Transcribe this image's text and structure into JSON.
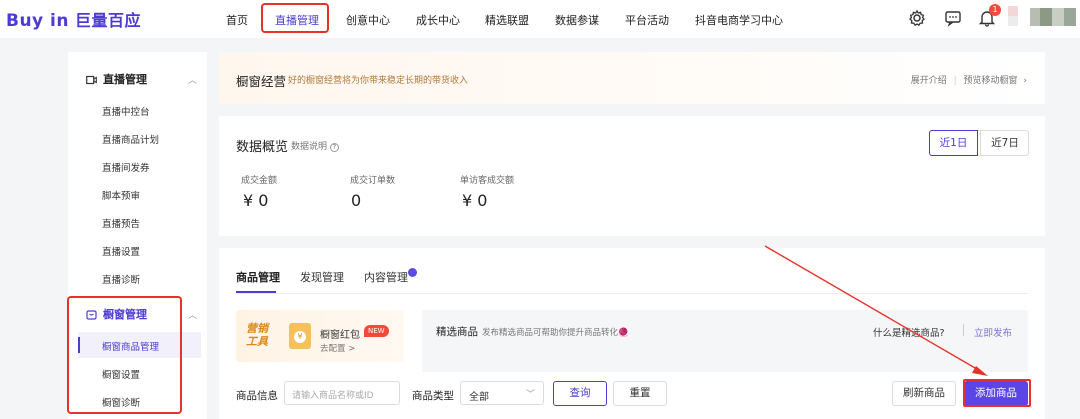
{
  "app": {
    "logo_text": "Buy in",
    "logo_cn": "巨量百应"
  },
  "nav": {
    "items": [
      "首页",
      "直播管理",
      "创意中心",
      "成长中心",
      "精选联盟",
      "数据参谋",
      "平台活动",
      "抖音电商学习中心"
    ],
    "notification_count": "1"
  },
  "sidebar": {
    "live_section": {
      "title": "直播管理",
      "items": [
        "直播中控台",
        "直播商品计划",
        "直播间发券",
        "脚本预审",
        "直播预告",
        "直播设置",
        "直播诊断"
      ]
    },
    "window_section": {
      "title": "橱窗管理",
      "items": [
        "橱窗商品管理",
        "橱窗设置",
        "橱窗诊断"
      ],
      "active_index": 0
    }
  },
  "banner": {
    "title": "橱窗经营",
    "subtitle": "好的橱窗经营将为你带来稳定长期的带货收入",
    "link_intro": "展开介绍",
    "link_preview": "预览移动橱窗",
    "separator": "|"
  },
  "overview": {
    "title": "数据概览",
    "help": "数据说明",
    "ranges": [
      "近1日",
      "近7日"
    ],
    "metrics": [
      {
        "label": "成交金额",
        "value": "¥ 0"
      },
      {
        "label": "成交订单数",
        "value": "0"
      },
      {
        "label": "单访客成交额",
        "value": "¥ 0"
      }
    ]
  },
  "goods": {
    "tabs": [
      "商品管理",
      "发现管理",
      "内容管理"
    ],
    "promo": {
      "tag": "营销工具",
      "name": "橱窗红包",
      "badge": "NEW",
      "sub": "去配置 >"
    },
    "featured": {
      "title": "精选商品",
      "desc": "发布精选商品可帮助你提升商品转化🧶",
      "question": "什么是精选商品?",
      "publish": "立即发布"
    },
    "filter": {
      "info_label": "商品信息",
      "info_placeholder": "请输入商品名称或ID",
      "type_label": "商品类型",
      "type_value": "全部",
      "query": "查询",
      "reset": "重置",
      "refresh": "刷新商品",
      "add": "添加商品"
    }
  },
  "colors": {
    "accent": "#4b3bd4",
    "button_primary": "#5b45e6",
    "highlight_red": "#e8312b"
  }
}
